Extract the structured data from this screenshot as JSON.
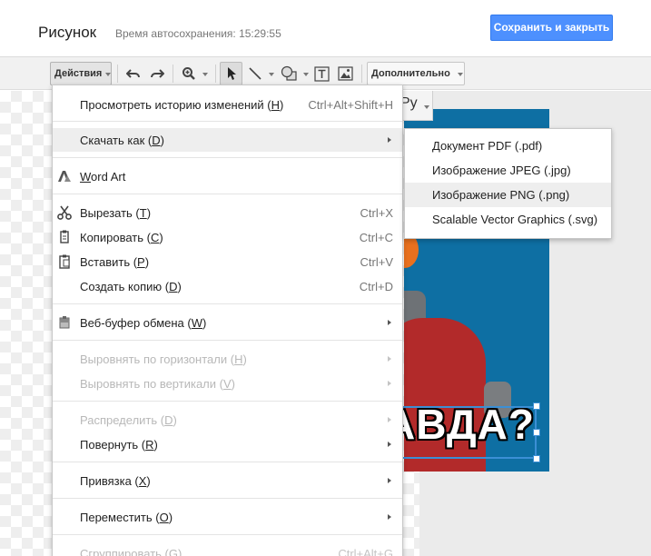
{
  "header": {
    "title": "Рисунок",
    "autosave": "Время автосохранения: 15:29:55",
    "save_button": "Сохранить и закрыть"
  },
  "toolbar": {
    "actions_label": "Действия",
    "more_label": "Дополнительно",
    "undo_icon": "undo-icon",
    "redo_icon": "redo-icon",
    "zoom_icon": "zoom-icon",
    "select_icon": "cursor-icon",
    "line_icon": "line-icon",
    "shape_icon": "shape-icon",
    "textbox_icon": "textbox-icon",
    "image_icon": "image-icon"
  },
  "canvas": {
    "meme_text": "АВДА?",
    "font_chip": "Py"
  },
  "menu": {
    "items": [
      {
        "pre": "Просмотреть историю изменений (",
        "mn": "Н",
        "post": ")",
        "shortcut": "Ctrl+Alt+Shift+H"
      },
      {
        "pre": "Скачать как (",
        "mn": "D",
        "post": ")"
      },
      {
        "pre": "",
        "mn": "W",
        "post": "ord Art"
      },
      {
        "pre": "Вырезать (",
        "mn": "Т",
        "post": ")",
        "shortcut": "Ctrl+X"
      },
      {
        "pre": "Копировать (",
        "mn": "С",
        "post": ")",
        "shortcut": "Ctrl+C"
      },
      {
        "pre": "Вставить (",
        "mn": "Р",
        "post": ")",
        "shortcut": "Ctrl+V"
      },
      {
        "pre": "Создать копию (",
        "mn": "D",
        "post": ")",
        "shortcut": "Ctrl+D"
      },
      {
        "pre": "Веб-буфер обмена (",
        "mn": "W",
        "post": ")"
      },
      {
        "pre": "Выровнять по горизонтали (",
        "mn": "H",
        "post": ")"
      },
      {
        "pre": "Выровнять по вертикали (",
        "mn": "V",
        "post": ")"
      },
      {
        "pre": "Распределить (",
        "mn": "D",
        "post": ")"
      },
      {
        "pre": "Повернуть (",
        "mn": "R",
        "post": ")"
      },
      {
        "pre": "Привязка (",
        "mn": "X",
        "post": ")"
      },
      {
        "pre": "Переместить (",
        "mn": "O",
        "post": ")"
      },
      {
        "pre": "Сгруппировать (",
        "mn": "G",
        "post": ")",
        "shortcut": "Ctrl+Alt+G"
      }
    ]
  },
  "submenu": {
    "items": [
      "Документ PDF (.pdf)",
      "Изображение JPEG (.jpg)",
      "Изображение PNG (.png)",
      "Scalable Vector Graphics (.svg)"
    ]
  },
  "colors": {
    "accent": "#4d90fe",
    "highlight": "#eeeeee",
    "image_blue": "#0e6fa3"
  }
}
